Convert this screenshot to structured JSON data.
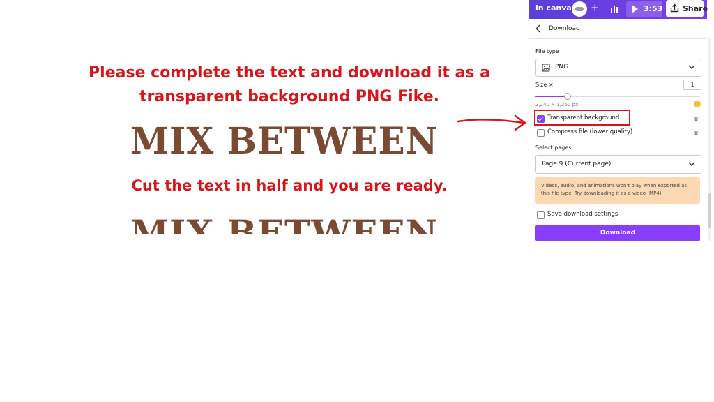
{
  "canvas": {
    "instruction_top": "Please complete the text and download it as a transparent background PNG Fike.",
    "headline_top": "MIX BETWEEN",
    "instruction_bottom": "Cut the text in half and you are ready.",
    "headline_bottom": "MIX BETWEEN"
  },
  "topbar": {
    "app_title": "in canva",
    "plus_label": "+",
    "video_time": "3:53",
    "share_label": "Share"
  },
  "download_panel": {
    "title": "Download",
    "file_type_label": "File type",
    "file_type_value": "PNG",
    "size_label": "Size ×",
    "size_value": "1",
    "size_slider_fraction": 0.19,
    "dimensions": "2,240 × 1,260 px",
    "transparent_label": "Transparent background",
    "transparent_checked": true,
    "compress_label": "Compress file (lower quality)",
    "compress_checked": false,
    "select_pages_label": "Select pages",
    "pages_value": "Page 9 (Current page)",
    "warning_text": "Videos, audio, and animations won't play when exported as this file type. Try downloading it as a video (MP4).",
    "save_settings_label": "Save download settings",
    "save_settings_checked": false,
    "download_button": "Download",
    "pro_icon": "♛"
  },
  "colors": {
    "accent": "#8b3dff",
    "instruction_red": "#d6161b",
    "headline_brown": "#7a4a33",
    "warning_bg": "#fcd9b3"
  },
  "icons": {
    "back": "chevron-left-icon",
    "chevron": "chevron-down-icon",
    "image": "image-icon",
    "play": "play-icon",
    "share": "share-icon",
    "analytics": "bar-chart-icon",
    "crown": "crown-icon"
  }
}
